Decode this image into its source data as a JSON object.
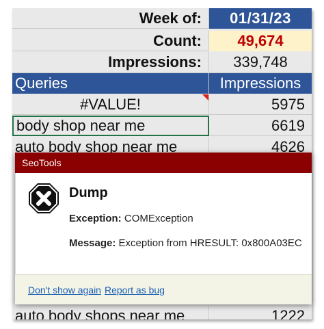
{
  "sheet": {
    "week_label": "Week of:",
    "week_value": "01/31/23",
    "count_label": "Count:",
    "count_value": "49,674",
    "impressions_label": "Impressions:",
    "impressions_value": "339,748",
    "table_header": {
      "queries": "Queries",
      "impressions": "Impressions"
    },
    "rows": [
      {
        "query": "#VALUE!",
        "impressions": "5975"
      },
      {
        "query": "body shop near me",
        "impressions": "6619"
      },
      {
        "query": "auto body shop near me",
        "impressions": "4626"
      },
      {
        "query": "auto body shops near me",
        "impressions": "1222"
      }
    ],
    "colors": {
      "header_blue": "#2e5597",
      "count_fill": "#fef2cb",
      "count_text": "#c00000",
      "selection": "#217346"
    }
  },
  "dialog": {
    "title": "SeoTools",
    "heading": "Dump",
    "exception_label": "Exception:",
    "exception_value": "COMException",
    "message_label": "Message:",
    "message_value": "Exception from HRESULT: 0x800A03EC",
    "dont_show_link": "Don't show again",
    "report_link": "Report as bug",
    "icon": "stop-error-icon",
    "colors": {
      "titlebar": "#8b0000",
      "link": "#1a5fb4"
    }
  }
}
